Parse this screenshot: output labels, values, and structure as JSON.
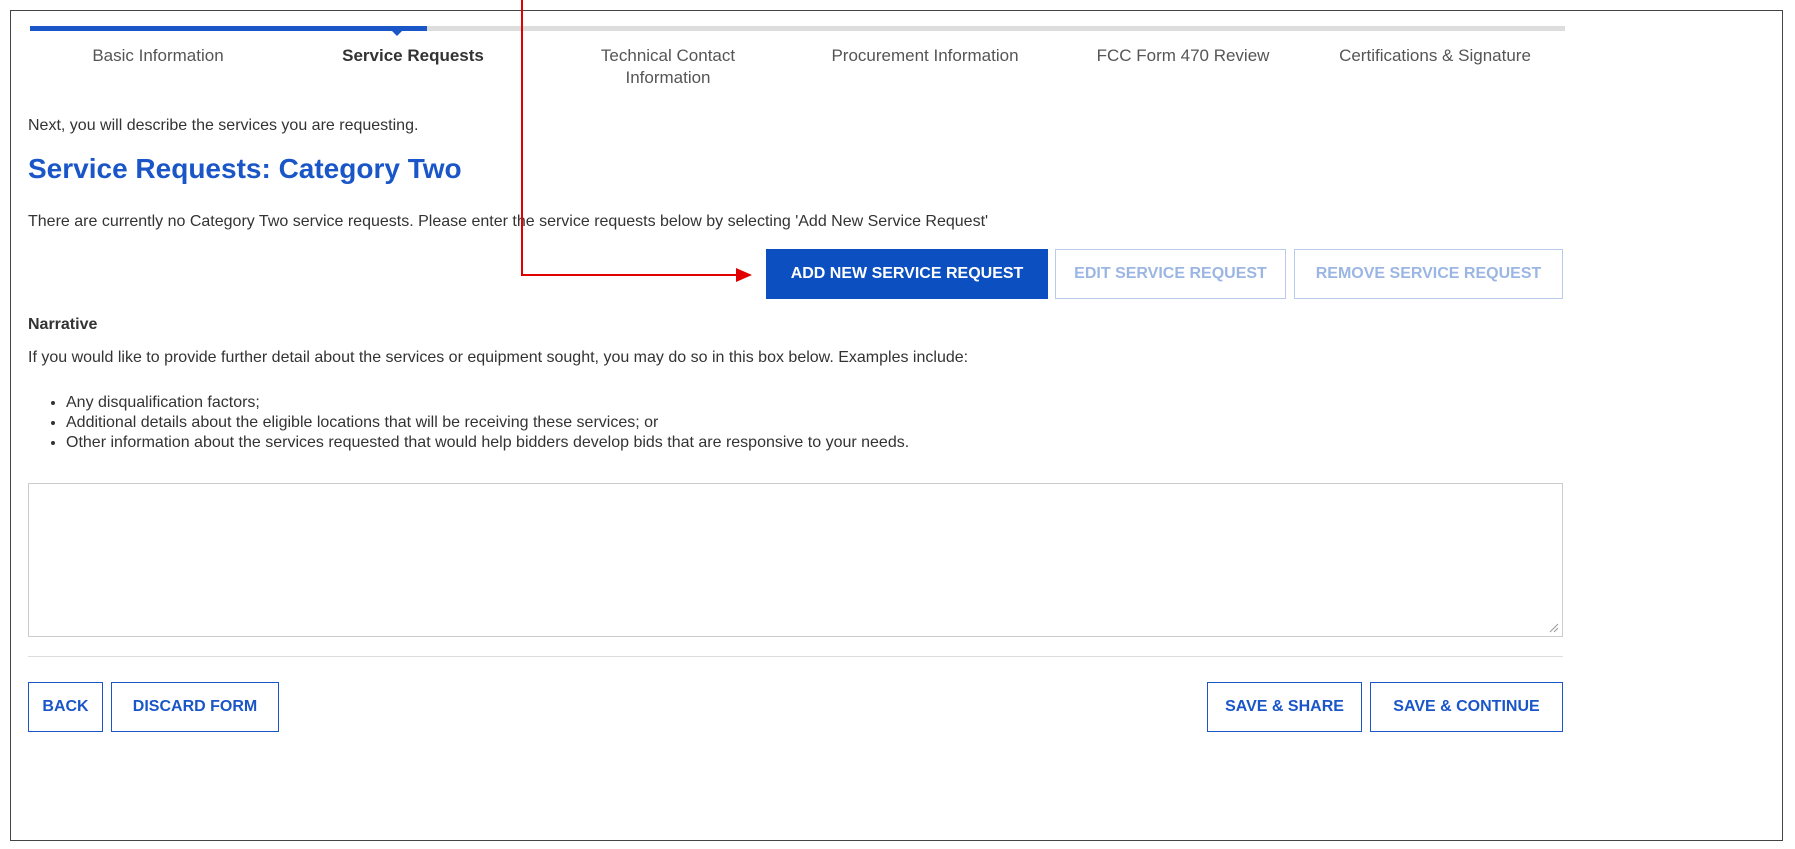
{
  "steps": [
    {
      "label": "Basic Information",
      "active": false
    },
    {
      "label": "Service Requests",
      "active": true
    },
    {
      "label_line1": "Technical Contact",
      "label_line2": "Information",
      "active": false
    },
    {
      "label": "Procurement Information",
      "active": false
    },
    {
      "label": "FCC Form 470 Review",
      "active": false
    },
    {
      "label": "Certifications & Signature",
      "active": false
    }
  ],
  "intro": "Next, you will describe the services you are requesting.",
  "title": "Service Requests: Category Two",
  "notice": "There are currently no Category Two service requests. Please enter the service requests below by selecting 'Add New Service Request'",
  "actions": {
    "add": "ADD NEW SERVICE REQUEST",
    "edit": "EDIT SERVICE REQUEST",
    "remove": "REMOVE SERVICE REQUEST"
  },
  "narrative": {
    "label": "Narrative",
    "description": "If you would like to provide further detail about the services or equipment sought, you may do so in this box below. Examples include:",
    "examples": [
      "Any disqualification factors;",
      "Additional details about the eligible locations that will be receiving these services; or",
      "Other information about the services requested that would help bidders develop bids that are responsive to your needs."
    ],
    "value": ""
  },
  "footer": {
    "back": "BACK",
    "discard": "DISCARD FORM",
    "save_share": "SAVE & SHARE",
    "save_continue": "SAVE & CONTINUE"
  },
  "colors": {
    "accent": "#1a56c8",
    "primary_button": "#0b4fc0",
    "annotation": "#e00000"
  }
}
